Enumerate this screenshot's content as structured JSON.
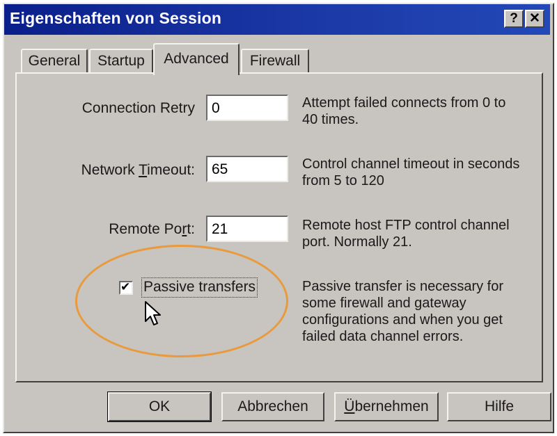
{
  "window": {
    "title": "Eigenschaften von Session",
    "help_glyph": "?",
    "close_glyph": "✕"
  },
  "tabs": [
    {
      "label": "General"
    },
    {
      "label": "Startup"
    },
    {
      "label": "Advanced"
    },
    {
      "label": "Firewall"
    }
  ],
  "active_tab": "Advanced",
  "settings": {
    "connection_retry": {
      "label": "Connection Retry",
      "value": "0",
      "description_line1": "Attempt failed connects from 0 to",
      "description_line2": "40 times."
    },
    "network_timeout": {
      "label_pre": "Network ",
      "label_mnemonic": "T",
      "label_post": "imeout:",
      "value": "65",
      "description_line1": "Control channel timeout in seconds",
      "description_line2": "from 5 to 120"
    },
    "remote_port": {
      "label_pre": "Remote Po",
      "label_mnemonic": "r",
      "label_post": "t:",
      "value": "21",
      "description_line1": "Remote host FTP control channel",
      "description_line2": "port. Normally 21."
    },
    "passive_transfers": {
      "label": "Passive transfers",
      "checked": true,
      "check_glyph": "✔",
      "description_line1": "Passive transfer is necessary for",
      "description_line2": "some firewall and gateway",
      "description_line3": "configurations and when you get",
      "description_line4": "failed data channel errors."
    }
  },
  "buttons": {
    "ok": "OK",
    "cancel": "Abbrechen",
    "apply_mnemonic": "Ü",
    "apply_rest": "bernehmen",
    "help": "Hilfe"
  },
  "highlight_color": "#e89a3c",
  "title_color": "#0a1f8a"
}
